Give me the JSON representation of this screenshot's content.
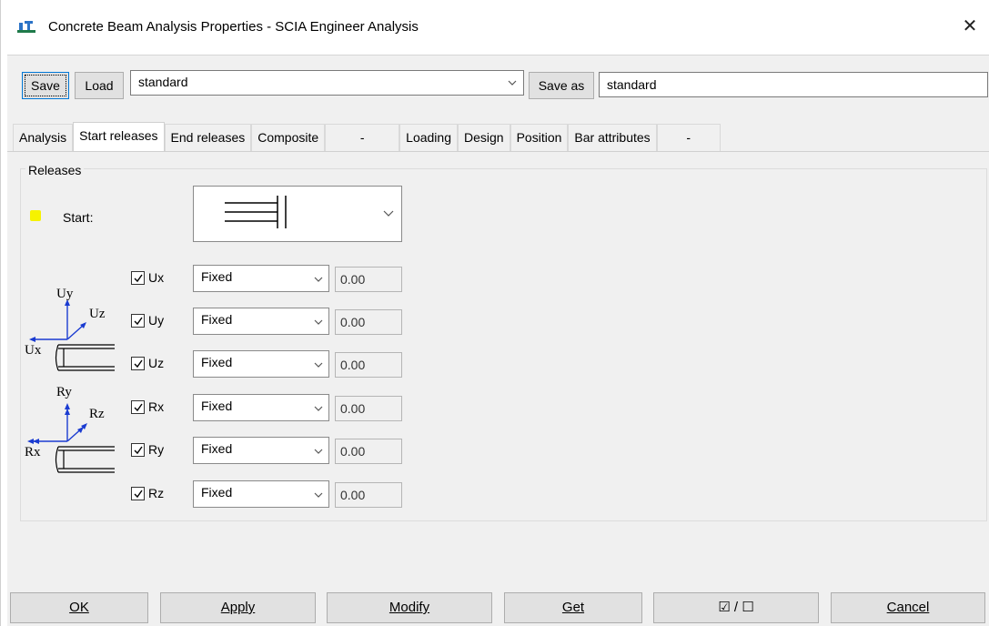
{
  "window": {
    "title": "Concrete Beam Analysis Properties - SCIA Engineer Analysis",
    "close_glyph": "✕"
  },
  "toolbar": {
    "save_label": "Save",
    "load_label": "Load",
    "preset_value": "standard",
    "save_as_label": "Save as",
    "save_as_name": "standard"
  },
  "tabs": [
    {
      "label": "Analysis"
    },
    {
      "label": "Start releases",
      "active": true
    },
    {
      "label": "End releases"
    },
    {
      "label": "Composite"
    },
    {
      "label": "-"
    },
    {
      "label": "Loading"
    },
    {
      "label": "Design"
    },
    {
      "label": "Position"
    },
    {
      "label": "Bar attributes"
    },
    {
      "label": "-"
    }
  ],
  "releases": {
    "group_label": "Releases",
    "start_label": "Start:",
    "indicator_color": "#f6f200",
    "rows": [
      {
        "label": "Ux",
        "checked": true,
        "option": "Fixed",
        "value": "0.00"
      },
      {
        "label": "Uy",
        "checked": true,
        "option": "Fixed",
        "value": "0.00"
      },
      {
        "label": "Uz",
        "checked": true,
        "option": "Fixed",
        "value": "0.00"
      },
      {
        "label": "Rx",
        "checked": true,
        "option": "Fixed",
        "value": "0.00"
      },
      {
        "label": "Ry",
        "checked": true,
        "option": "Fixed",
        "value": "0.00"
      },
      {
        "label": "Rz",
        "checked": true,
        "option": "Fixed",
        "value": "0.00"
      }
    ],
    "diagram_translation": {
      "y": "Uy",
      "z": "Uz",
      "x": "Ux"
    },
    "diagram_rotation": {
      "y": "Ry",
      "z": "Rz",
      "x": "Rx"
    },
    "axis_color": "#1a3bd1"
  },
  "footer": {
    "ok": "OK",
    "apply": "Apply",
    "modify": "Modify",
    "get": "Get",
    "check_toggle": "☑ / ☐",
    "cancel": "Cancel"
  }
}
